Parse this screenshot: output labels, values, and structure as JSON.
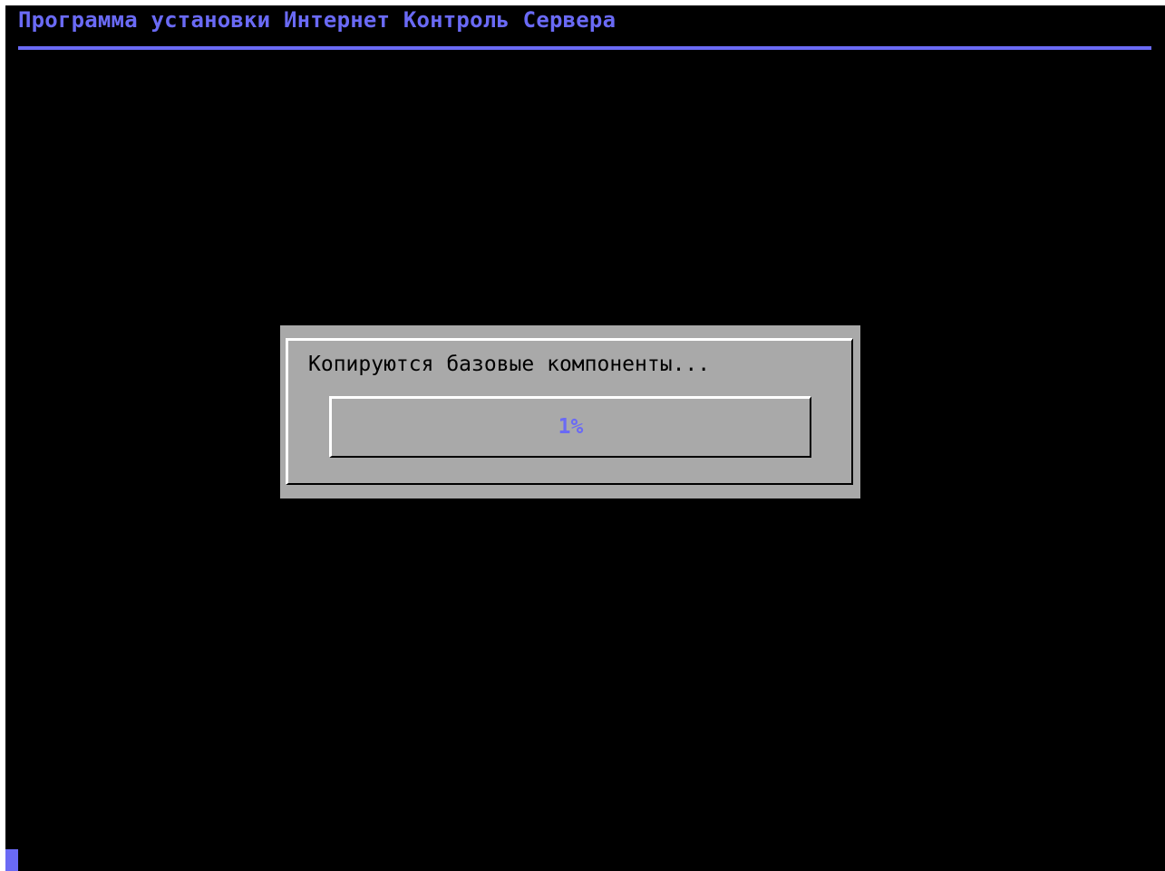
{
  "header": {
    "title": "Программа установки Интернет Контроль Сервера"
  },
  "dialog": {
    "message": "Копируются базовые компоненты...",
    "progress": {
      "percent": 1,
      "label": "1%"
    }
  },
  "colors": {
    "accent": "#6a6af5",
    "background": "#000000",
    "dialog": "#a9a9a9"
  }
}
